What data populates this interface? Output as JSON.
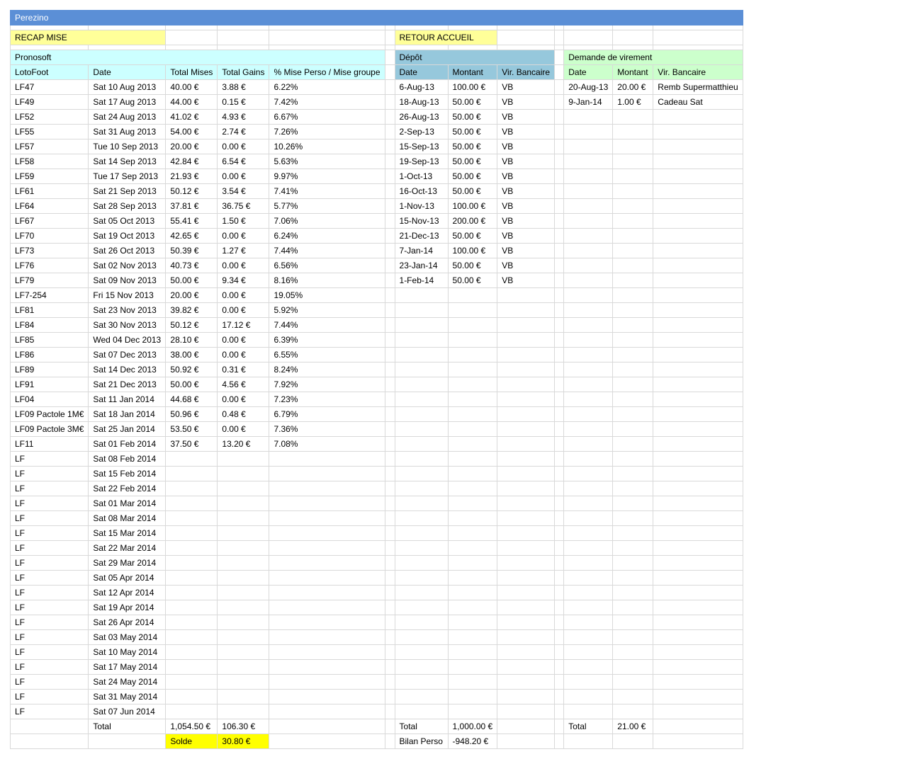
{
  "title": "Perezino",
  "recap_label": "RECAP MISE",
  "retour_label": "RETOUR ACCUEIL",
  "pronosoft": {
    "section_label": "Pronosoft",
    "headers": [
      "LotoFoot",
      "Date",
      "Total Mises",
      "Total Gains",
      "% Mise Perso / Mise groupe"
    ],
    "rows": [
      [
        "LF47",
        "Sat 10 Aug 2013",
        "40.00 €",
        "3.88 €",
        "6.22%"
      ],
      [
        "LF49",
        "Sat 17 Aug 2013",
        "44.00 €",
        "0.15 €",
        "7.42%"
      ],
      [
        "LF52",
        "Sat 24 Aug 2013",
        "41.02 €",
        "4.93 €",
        "6.67%"
      ],
      [
        "LF55",
        "Sat 31 Aug 2013",
        "54.00 €",
        "2.74 €",
        "7.26%"
      ],
      [
        "LF57",
        "Tue 10 Sep 2013",
        "20.00 €",
        "0.00 €",
        "10.26%"
      ],
      [
        "LF58",
        "Sat 14 Sep 2013",
        "42.84 €",
        "6.54 €",
        "5.63%"
      ],
      [
        "LF59",
        "Tue 17 Sep 2013",
        "21.93 €",
        "0.00 €",
        "9.97%"
      ],
      [
        "LF61",
        "Sat 21 Sep 2013",
        "50.12 €",
        "3.54 €",
        "7.41%"
      ],
      [
        "LF64",
        "Sat 28 Sep 2013",
        "37.81 €",
        "36.75 €",
        "5.77%"
      ],
      [
        "LF67",
        "Sat 05 Oct 2013",
        "55.41 €",
        "1.50 €",
        "7.06%"
      ],
      [
        "LF70",
        "Sat 19 Oct 2013",
        "42.65 €",
        "0.00 €",
        "6.24%"
      ],
      [
        "LF73",
        "Sat 26 Oct 2013",
        "50.39 €",
        "1.27 €",
        "7.44%"
      ],
      [
        "LF76",
        "Sat 02 Nov 2013",
        "40.73 €",
        "0.00 €",
        "6.56%"
      ],
      [
        "LF79",
        "Sat 09 Nov 2013",
        "50.00 €",
        "9.34 €",
        "8.16%"
      ],
      [
        "LF7-254",
        "Fri 15 Nov 2013",
        "20.00 €",
        "0.00 €",
        "19.05%"
      ],
      [
        "LF81",
        "Sat 23 Nov 2013",
        "39.82 €",
        "0.00 €",
        "5.92%"
      ],
      [
        "LF84",
        "Sat 30 Nov 2013",
        "50.12 €",
        "17.12 €",
        "7.44%"
      ],
      [
        "LF85",
        "Wed 04 Dec 2013",
        "28.10 €",
        "0.00 €",
        "6.39%"
      ],
      [
        "LF86",
        "Sat 07 Dec 2013",
        "38.00 €",
        "0.00 €",
        "6.55%"
      ],
      [
        "LF89",
        "Sat 14 Dec 2013",
        "50.92 €",
        "0.31 €",
        "8.24%"
      ],
      [
        "LF91",
        "Sat 21 Dec 2013",
        "50.00 €",
        "4.56 €",
        "7.92%"
      ],
      [
        "LF04",
        "Sat 11 Jan 2014",
        "44.68 €",
        "0.00 €",
        "7.23%"
      ],
      [
        "LF09 Pactole 1M€",
        "Sat 18 Jan 2014",
        "50.96 €",
        "0.48 €",
        "6.79%"
      ],
      [
        "LF09 Pactole 3M€",
        "Sat 25 Jan 2014",
        "53.50 €",
        "0.00 €",
        "7.36%"
      ],
      [
        "LF11",
        "Sat 01 Feb 2014",
        "37.50 €",
        "13.20 €",
        "7.08%"
      ],
      [
        "LF",
        "Sat 08 Feb 2014",
        "",
        "",
        ""
      ],
      [
        "LF",
        "Sat 15 Feb 2014",
        "",
        "",
        ""
      ],
      [
        "LF",
        "Sat 22 Feb 2014",
        "",
        "",
        ""
      ],
      [
        "LF",
        "Sat 01 Mar 2014",
        "",
        "",
        ""
      ],
      [
        "LF",
        "Sat 08 Mar 2014",
        "",
        "",
        ""
      ],
      [
        "LF",
        "Sat 15 Mar 2014",
        "",
        "",
        ""
      ],
      [
        "LF",
        "Sat 22 Mar 2014",
        "",
        "",
        ""
      ],
      [
        "LF",
        "Sat 29 Mar 2014",
        "",
        "",
        ""
      ],
      [
        "LF",
        "Sat 05 Apr 2014",
        "",
        "",
        ""
      ],
      [
        "LF",
        "Sat 12 Apr 2014",
        "",
        "",
        ""
      ],
      [
        "LF",
        "Sat 19 Apr 2014",
        "",
        "",
        ""
      ],
      [
        "LF",
        "Sat 26 Apr 2014",
        "",
        "",
        ""
      ],
      [
        "LF",
        "Sat 03 May 2014",
        "",
        "",
        ""
      ],
      [
        "LF",
        "Sat 10 May 2014",
        "",
        "",
        ""
      ],
      [
        "LF",
        "Sat 17 May 2014",
        "",
        "",
        ""
      ],
      [
        "LF",
        "Sat 24 May 2014",
        "",
        "",
        ""
      ],
      [
        "LF",
        "Sat 31 May 2014",
        "",
        "",
        ""
      ],
      [
        "LF",
        "Sat 07 Jun 2014",
        "",
        "",
        ""
      ]
    ],
    "total_label": "Total",
    "total_mises": "1,054.50 €",
    "total_gains": "106.30 €",
    "solde_label": "Solde",
    "solde_value": "30.80 €"
  },
  "depot": {
    "section_label": "Dépôt",
    "headers": [
      "Date",
      "Montant",
      "Vir. Bancaire"
    ],
    "rows": [
      [
        "6-Aug-13",
        "100.00 €",
        "VB"
      ],
      [
        "18-Aug-13",
        "50.00 €",
        "VB"
      ],
      [
        "26-Aug-13",
        "50.00 €",
        "VB"
      ],
      [
        "2-Sep-13",
        "50.00 €",
        "VB"
      ],
      [
        "15-Sep-13",
        "50.00 €",
        "VB"
      ],
      [
        "19-Sep-13",
        "50.00 €",
        "VB"
      ],
      [
        "1-Oct-13",
        "50.00 €",
        "VB"
      ],
      [
        "16-Oct-13",
        "50.00 €",
        "VB"
      ],
      [
        "1-Nov-13",
        "100.00 €",
        "VB"
      ],
      [
        "15-Nov-13",
        "200.00 €",
        "VB"
      ],
      [
        "21-Dec-13",
        "50.00 €",
        "VB"
      ],
      [
        "7-Jan-14",
        "100.00 €",
        "VB"
      ],
      [
        "23-Jan-14",
        "50.00 €",
        "VB"
      ],
      [
        "1-Feb-14",
        "50.00 €",
        "VB"
      ]
    ],
    "total_label": "Total",
    "total_value": "1,000.00 €",
    "bilan_label": "Bilan Perso",
    "bilan_value": "-948.20 €"
  },
  "virement": {
    "section_label": "Demande de virement",
    "headers": [
      "Date",
      "Montant",
      "Vir. Bancaire"
    ],
    "rows": [
      [
        "20-Aug-13",
        "20.00 €",
        "Remb Supermatthieu"
      ],
      [
        "9-Jan-14",
        "1.00 €",
        "Cadeau Sat"
      ]
    ],
    "total_label": "Total",
    "total_value": "21.00 €"
  },
  "colors": {
    "title_bar": "#5b8fd6",
    "recap": "#ffff99",
    "pronosoft": "#ccffff",
    "depot": "#96c8dc",
    "virement": "#ccffcc",
    "solde": "#ffff00"
  }
}
